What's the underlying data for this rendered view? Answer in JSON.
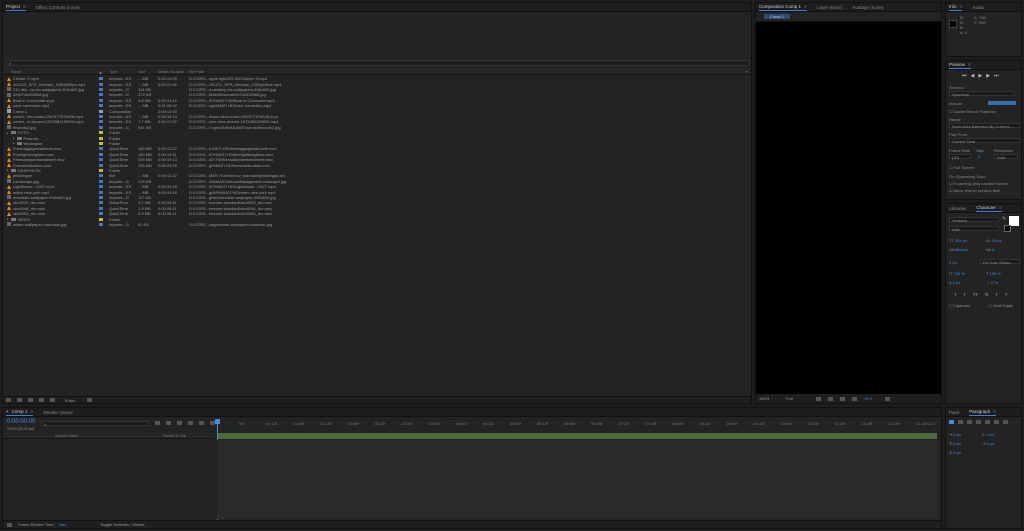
{
  "project": {
    "tabs": [
      "Project",
      "Effect Controls (none)"
    ],
    "headers": [
      "Name",
      "Type",
      "Size",
      "Media Duration",
      "File Path"
    ],
    "rows": [
      {
        "n": "Climax~2.mp4",
        "t": "Importe...ES",
        "s": "... MB",
        "d": "0:00:14:09",
        "p": "D:\\CORS...ught\\ light\\ATI HD\\Climax~2.mp4",
        "i": "cone",
        "c": "#4a78b8"
      },
      {
        "n": "161212_EPS_Vietnam_1080p60fps.mp4",
        "t": "Importe...ES",
        "s": "... MB",
        "d": "0:00:21:06",
        "p": "D:\\CORS...161212_EPS_Vietnam_1080p60fps.mp4",
        "i": "cone",
        "c": "#4a78b8"
      },
      {
        "n": "211 des...op-hd-wallpapers-906x600.jpg",
        "t": "Importe...G",
        "s": "119 KB",
        "d": "",
        "p": "D:\\CORS...d-desktop-hd-wallpapers-906x600.jpg",
        "i": "file",
        "c": "#4a78b8"
      },
      {
        "n": "de9c7cb334068.jpg",
        "t": "Importe...G",
        "s": "372 KB",
        "d": "",
        "p": "D:\\CORS...MAI\\Afirace\\de9c7cb334068.jpg",
        "i": "file",
        "c": "#4a78b8"
      },
      {
        "n": "Boat in Colormatri.mp4",
        "t": "Importe...ES",
        "s": "4.8 MB",
        "d": "0:00:14:15",
        "p": "D:\\CORS...IFH\\MATI HD\\Boat in Colormatri.mp4",
        "i": "cone",
        "c": "#4a78b8"
      },
      {
        "n": "color correction.mp4",
        "t": "Importe...ES",
        "s": "... MB",
        "d": "0:01:09:02",
        "p": "D:\\CORS...ught\\MATI HD\\color correction.mp4",
        "i": "cone",
        "c": "#4a78b8"
      },
      {
        "n": "Comp 1",
        "t": "Composition",
        "s": "",
        "d": "0:00:13:00",
        "p": "",
        "i": "comp",
        "c": "#8fa2bc"
      },
      {
        "n": "coverr...eer-coast-1567877576628.mp4",
        "t": "Importe...ES",
        "s": "... MB",
        "d": "0:00:16:13",
        "p": "D:\\CORS...\\back-view-coast-1567877576628.mp4",
        "i": "cone",
        "c": "#4a78b8"
      },
      {
        "n": "coverr...er-around-1575383159000.mp4",
        "t": "Importe...ES",
        "s": "7.7 MB",
        "d": "0:00:17:07",
        "p": "D:\\CORS...\\svc-view-around-1575383159000.mp4",
        "i": "cone",
        "c": "#4a78b8"
      },
      {
        "n": "fbwords2.jpg",
        "t": "Importe...G",
        "s": "341 KB",
        "d": "",
        "p": "D:\\CORS...I ught\\ANIMASIAMT\\words\\fbwords2.jpg",
        "i": "file",
        "c": "#4a78b8"
      },
      {
        "n": "FOTO",
        "t": "Folder",
        "s": "",
        "d": "",
        "p": "",
        "i": "folder",
        "c": "#c9b83b"
      },
      {
        "n": "Polaroid",
        "t": "Folder",
        "s": "",
        "d": "",
        "p": "",
        "i": "folder",
        "c": "#c9b83b",
        "ind": 1
      },
      {
        "n": "Wonlagine",
        "t": "Folder",
        "s": "",
        "d": "",
        "p": "",
        "i": "folder",
        "c": "#c9b83b",
        "ind": 1
      },
      {
        "n": "Freebaggagestaircloth.mov",
        "t": "QuickTime",
        "s": "180 MB",
        "d": "0:00:12:22",
        "p": "D:\\CORS...ILMATI HD\\freebaggagestaircloth.mov",
        "i": "cone",
        "c": "#4a78b8"
      },
      {
        "n": "Freelightleniglides.mov",
        "t": "QuickTime",
        "s": "160 MB",
        "d": "0:00:15:11",
        "p": "D:\\CORS...IFH\\MATI HD\\freelightleniglides.mov",
        "i": "cone",
        "c": "#4a78b8"
      },
      {
        "n": "Freesolarpanelsindesert.mov",
        "t": "QuickTime",
        "s": "205 MB",
        "d": "0:00:19:13",
        "p": "D:\\CORS...ATI HD\\freesolarpanelsindesert.mov",
        "i": "cone",
        "c": "#4a78b8"
      },
      {
        "n": "Freeworldbulbes.mov",
        "t": "QuickTime",
        "s": "154 MB",
        "d": "0:00:23:05",
        "p": "D:\\CORS...ght\\MATI HD\\freeworldbulbes.mov",
        "i": "cone",
        "c": "#4a78b8"
      },
      {
        "n": "GRAPHICSK",
        "t": "Folder",
        "s": "",
        "d": "",
        "p": "",
        "i": "folder",
        "c": "#c9b83b"
      },
      {
        "n": "jetskilngan",
        "t": "AVI",
        "s": "... MB",
        "d": "0:00:14:22",
        "p": "D:\\CORS...MATI HD\\freemov_standard\\jetskilngan.avi",
        "i": "cone",
        "c": "#4a78b8"
      },
      {
        "n": "Landscape.jpg",
        "t": "Importe...G",
        "s": "475 KB",
        "d": "",
        "p": "D:\\CORS...ANIMASI\\Afirace\\Backgame\\Landscape.jpg",
        "i": "file",
        "c": "#4a78b8"
      },
      {
        "n": "Lighthouse - 1927.mp4",
        "t": "Importe...ES",
        "s": "... MB",
        "d": "0:00:31:09",
        "p": "D:\\CORS...IIFH\\MATI HD\\Lighthouse - 1927.mp4",
        "i": "cone",
        "c": "#4a78b8"
      },
      {
        "n": "metro new york.mp4",
        "t": "Importe...ES",
        "s": "... MB",
        "d": "0:00:04:16",
        "p": "D:\\CORS...ght\\FH\\MATI HD\\metro new york.mp4",
        "i": "cone",
        "c": "#4a78b8"
      },
      {
        "n": "mountain-wallpaper-906x600.jpg",
        "t": "Importe...G",
        "s": "117 KB",
        "d": "",
        "p": "D:\\CORS...ghts\\mountain-wallpaper-906x600.jpg",
        "i": "file",
        "c": "#4a78b8"
      },
      {
        "n": "vbo0029_rbo.mov",
        "t": "QuickTime",
        "s": "3.2 MB",
        "d": "0:00:06:11",
        "p": "D:\\CORS...frezone standard\\vbo0029_rbo.mov",
        "i": "cone",
        "c": "#4a78b8"
      },
      {
        "n": "vbo0046_rbo.mov",
        "t": "QuickTime",
        "s": "1.9 MB",
        "d": "0:00:06:11",
        "p": "D:\\CORS...frezone standard\\vbo0046_rbo.mov",
        "i": "cone",
        "c": "#4a78b8"
      },
      {
        "n": "vbo0053_rbo.mov",
        "t": "QuickTime",
        "s": "3.9 MB",
        "d": "0:00:06:11",
        "p": "D:\\CORS...frezone standard\\vbo0053_rbo.mov",
        "i": "cone",
        "c": "#4a78b8"
      },
      {
        "n": "VIDEO",
        "t": "Folder",
        "s": "",
        "d": "",
        "p": "",
        "i": "folder",
        "c": "#c9b83b"
      },
      {
        "n": "winter-wallpaper-mountain.jpg",
        "t": "Importe...G",
        "s": "81 KB",
        "d": "",
        "p": "D:\\CORS...ltage\\winter-wallpaper-mountain.jpg",
        "i": "file",
        "c": "#4a78b8"
      }
    ],
    "bpc": "8 bpc"
  },
  "viewer": {
    "tabs": [
      "Composition Comp 1",
      "Layer (none)",
      "Footage (none)"
    ],
    "subtab": "Comp 1",
    "zoom": "100%",
    "quality": "Full",
    "exposure": "+0.0"
  },
  "info": {
    "tabs": [
      "Info",
      "Audio"
    ],
    "lines": [
      "X: 738",
      "Y: 310",
      "R:",
      "G:",
      "B:",
      "A: 0"
    ]
  },
  "preview": {
    "title": "Preview",
    "shortcut_label": "Shortcut",
    "shortcut": "Spacebar",
    "include": "Include:",
    "cache": "Cache Before Playback",
    "range_label": "Range",
    "range": "Work Area Extended By Current...",
    "play_from_label": "Play From",
    "play_from": "Current Time",
    "fr_label": "Frame Rate",
    "skip_label": "Skip",
    "res_label": "Resolution",
    "fr": "(30)",
    "skip": "0",
    "res": "Auto",
    "fullscreen": "Full Screen",
    "stop_label": "On (Spacebar) Stop:",
    "stop1": "If caching, play cached frames",
    "stop2": "Move time to preview time"
  },
  "character": {
    "tabs": [
      "Libraries",
      "Character"
    ],
    "font": "Verdana",
    "style": "Italic",
    "size": "294 px",
    "leading": "40 px",
    "kern": "Metrics",
    "track": "0",
    "unit": "px",
    "stroke": "Fill Over Stroke",
    "vscale": "100 %",
    "hscale": "100 %",
    "baseline": "0 px",
    "tsume": "0 %",
    "ligatures": "Ligatures",
    "hindi": "Hindi Digits",
    "styles": [
      "T",
      "T",
      "TT",
      "Tt",
      "T",
      "T"
    ]
  },
  "paragraph": {
    "tabs": [
      "Paragraph"
    ],
    "vals": [
      "0 px",
      "0 px",
      "0 px",
      "0 px",
      "0 px"
    ]
  },
  "timeline": {
    "tabs": [
      "Comp 1",
      "Render Queue"
    ],
    "timecode": "0:00:00:00",
    "fps": "00000 (30.00 fps)",
    "layer_headers": [
      "Source Name",
      "Parent & Link"
    ],
    "ruler": [
      "00f",
      "00:15f",
      "01:00f",
      "01:15f",
      "02:00f",
      "02:15f",
      "03:00f",
      "03:15f",
      "04:00f",
      "04:15f",
      "05:00f",
      "05:15f",
      "06:00f",
      "06:15f",
      "07:00f",
      "07:15f",
      "08:00f",
      "08:15f",
      "09:00f",
      "09:15f",
      "10:00f",
      "10:15f",
      "11:00f",
      "11:15f",
      "12:00f",
      "12:15f"
    ],
    "end": "13:0",
    "render_label": "Frame Render Time:",
    "render": "0ms",
    "toggle": "Toggle Switches / Modes"
  }
}
